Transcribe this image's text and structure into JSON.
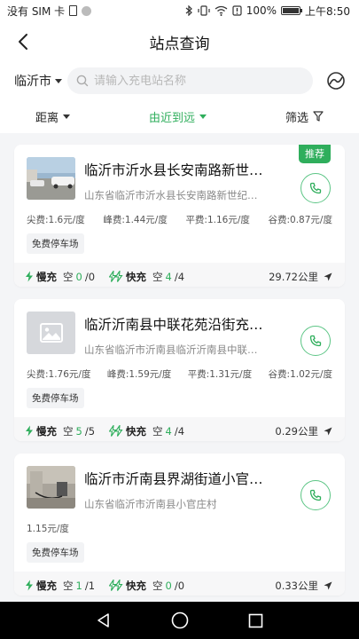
{
  "status_bar": {
    "carrier": "没有 SIM 卡",
    "battery": "100%",
    "time": "上午8:50"
  },
  "header": {
    "title": "站点查询"
  },
  "search": {
    "city": "临沂市",
    "placeholder": "请输入充电站名称"
  },
  "filters": [
    {
      "label": "距离"
    },
    {
      "label": "由近到远",
      "active": true
    },
    {
      "label": "筛选"
    }
  ],
  "labels": {
    "slow": "慢充",
    "fast": "快充",
    "free": "空"
  },
  "stations": [
    {
      "badge": "推荐",
      "name": "临沂市沂水县长安南路新世…",
      "address": "山东省临沂市沂水县长安南路新世纪…",
      "prices": [
        "尖费:1.6元/度",
        "峰费:1.44元/度",
        "平费:1.16元/度",
        "谷费:0.87元/度"
      ],
      "tag": "免费停车场",
      "slow": {
        "free": "0",
        "total": "/0"
      },
      "fast": {
        "free": "4",
        "total": "/4"
      },
      "distance": "29.72公里",
      "image": "photo"
    },
    {
      "name": "临沂沂南县中联花苑沿街充…",
      "address": "山东省临沂市沂南县临沂沂南县中联…",
      "prices": [
        "尖费:1.76元/度",
        "峰费:1.59元/度",
        "平费:1.31元/度",
        "谷费:1.02元/度"
      ],
      "tag": "免费停车场",
      "slow": {
        "free": "5",
        "total": "/5"
      },
      "fast": {
        "free": "4",
        "total": "/4"
      },
      "distance": "0.29公里",
      "image": "placeholder"
    },
    {
      "name": "临沂市沂南县界湖街道小官…",
      "address": "山东省临沂市沂南县小官庄村",
      "prices": [
        "1.15元/度"
      ],
      "tag": "免费停车场",
      "slow": {
        "free": "1",
        "total": "/1"
      },
      "fast": {
        "free": "0",
        "total": "/0"
      },
      "distance": "0.33公里",
      "image": "photo"
    }
  ],
  "colors": {
    "accent": "#2fae5c",
    "background": "#f4f5f7"
  },
  "icons": [
    "back-arrow-icon",
    "search-icon",
    "map-switch-icon",
    "filter-icon",
    "phone-icon",
    "lightning-icon",
    "fast-charge-icon",
    "navigate-arrow-icon",
    "nav-back-icon",
    "nav-home-icon",
    "nav-recents-icon"
  ]
}
